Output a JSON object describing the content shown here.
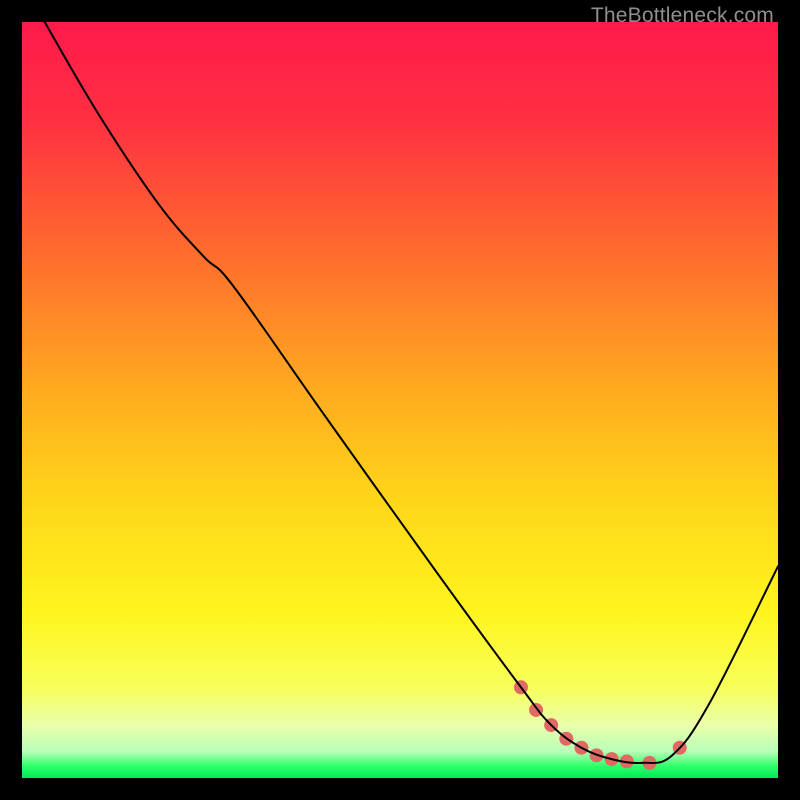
{
  "watermark": "TheBottleneck.com",
  "chart_data": {
    "type": "line",
    "title": "",
    "xlabel": "",
    "ylabel": "",
    "xlim": [
      0,
      100
    ],
    "ylim": [
      0,
      100
    ],
    "grid": false,
    "legend": false,
    "gradient_stops": [
      {
        "offset": 0.0,
        "color": "#ff1a4b"
      },
      {
        "offset": 0.13,
        "color": "#ff3042"
      },
      {
        "offset": 0.3,
        "color": "#ff6a2e"
      },
      {
        "offset": 0.48,
        "color": "#ffa820"
      },
      {
        "offset": 0.62,
        "color": "#ffd31a"
      },
      {
        "offset": 0.78,
        "color": "#fff51e"
      },
      {
        "offset": 0.88,
        "color": "#f8ff5a"
      },
      {
        "offset": 0.93,
        "color": "#eaffab"
      },
      {
        "offset": 0.965,
        "color": "#b8ffb8"
      },
      {
        "offset": 0.985,
        "color": "#2bff66"
      },
      {
        "offset": 1.0,
        "color": "#00e85a"
      }
    ],
    "series": [
      {
        "name": "bottleneck-curve",
        "color": "#000000",
        "stroke_width": 2,
        "x": [
          3,
          10,
          18,
          24,
          28,
          40,
          55,
          66,
          70,
          74,
          78,
          82,
          86,
          91,
          100
        ],
        "y": [
          100,
          88,
          76,
          69,
          65,
          48,
          27,
          12,
          7,
          4,
          2.5,
          2,
          3,
          10,
          28
        ]
      }
    ],
    "markers": {
      "name": "highlight-dots",
      "color": "#e06a63",
      "radius": 7,
      "points": [
        {
          "x": 66,
          "y": 12
        },
        {
          "x": 68,
          "y": 9
        },
        {
          "x": 70,
          "y": 7
        },
        {
          "x": 72,
          "y": 5.2
        },
        {
          "x": 74,
          "y": 4
        },
        {
          "x": 76,
          "y": 3
        },
        {
          "x": 78,
          "y": 2.5
        },
        {
          "x": 80,
          "y": 2.2
        },
        {
          "x": 83,
          "y": 2
        },
        {
          "x": 87,
          "y": 4
        }
      ]
    }
  }
}
